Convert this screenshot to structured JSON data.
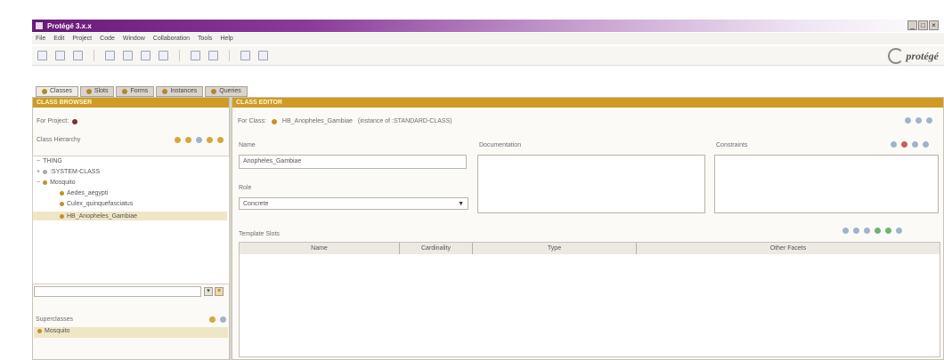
{
  "window": {
    "title": "Protégé 3.x.x",
    "controls": [
      "_",
      "□",
      "×"
    ]
  },
  "menu": [
    "File",
    "Edit",
    "Project",
    "Code",
    "Window",
    "Collaboration",
    "Tools",
    "Help"
  ],
  "toolbar": {
    "buttons": [
      "new-icon",
      "open-icon",
      "save-icon",
      "cut-icon",
      "copy-icon",
      "paste-icon",
      "undo-icon",
      "redo-icon",
      "find-icon",
      "help-icon",
      "previous-icon",
      "next-icon"
    ],
    "logo_text": "protégé"
  },
  "tabs": [
    {
      "label": "Classes",
      "active": true
    },
    {
      "label": "Slots",
      "active": false
    },
    {
      "label": "Forms",
      "active": false
    },
    {
      "label": "Instances",
      "active": false
    },
    {
      "label": "Queries",
      "active": false
    }
  ],
  "left": {
    "header": "CLASS BROWSER",
    "for_project_label": "For Project:",
    "hierarchy_label": "Class Hierarchy",
    "tree": [
      {
        "label": "THING",
        "level": 0,
        "icon": "grey"
      },
      {
        "label": ":SYSTEM-CLASS",
        "level": 1,
        "icon": "grey"
      },
      {
        "label": "Mosquito",
        "level": 1,
        "icon": "gold"
      },
      {
        "label": "Aedes_aegypti",
        "level": 2,
        "icon": "gold"
      },
      {
        "label": "Culex_quinquefasciatus",
        "level": 2,
        "icon": "gold"
      },
      {
        "label": "HB_Anopheles_Gambiae",
        "level": 2,
        "icon": "gold",
        "selected": true
      }
    ],
    "superclasses_label": "Superclasses",
    "superclasses": [
      "Mosquito"
    ]
  },
  "right": {
    "header": "CLASS EDITOR",
    "for_class_label": "For Class:",
    "for_class_value": "HB_Anopheles_Gambiae",
    "instance_of": "(instance of :STANDARD-CLASS)",
    "name_label": "Name",
    "name_value": "Anopheles_Gambiae",
    "documentation_label": "Documentation",
    "constraints_label": "Constraints",
    "role_label": "Role",
    "role_value": "Concrete",
    "template_slots_label": "Template Slots",
    "table_headers": [
      "Name",
      "Cardinality",
      "Type",
      "Other Facets"
    ]
  },
  "colors": {
    "gold": "#cf9b24",
    "title_purple": "#6a1a7a"
  }
}
